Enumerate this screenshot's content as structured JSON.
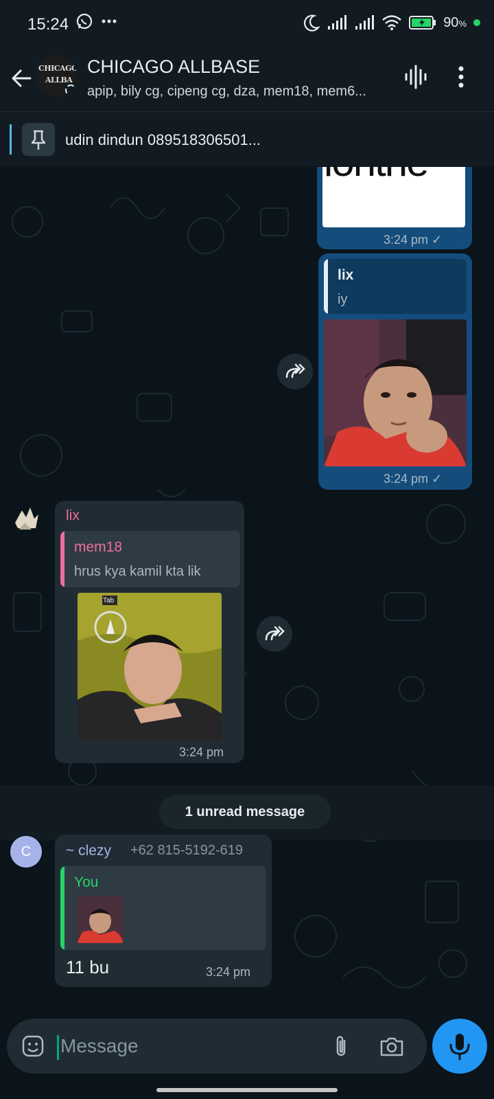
{
  "status_bar": {
    "time": "15:24",
    "battery_percent": "90",
    "battery_suffix": "%"
  },
  "header": {
    "title": "CHICAGO ALLBASE",
    "subtitle": "apip, bily cg, cipeng cg, dza, mem18, mem6...",
    "avatar_text_1": "CHICAGO",
    "avatar_text_2": "ALLBA"
  },
  "pinned": {
    "text": "udin dindun 089518306501..."
  },
  "messages": {
    "m1": {
      "partial_text": "ionthe",
      "time": "3:24 pm"
    },
    "m2": {
      "quote_name": "lix",
      "quote_text": "iy",
      "time": "3:24 pm"
    },
    "m3": {
      "sender": "lix",
      "quote_name": "mem18",
      "quote_text": "hrus kya kamil kta lik",
      "photo_label": "Tab",
      "time": "3:24 pm"
    },
    "unread": "1 unread message",
    "m4": {
      "sender": "~ clezy",
      "phone": "+62 815-5192-619",
      "quote_name": "You",
      "text": "11 bu",
      "time": "3:24 pm",
      "avatar_letter": "C"
    }
  },
  "input": {
    "placeholder": "Message"
  },
  "colors": {
    "accent": "#00a884",
    "bubble_out": "#144d7c",
    "bubble_in": "#202c33",
    "mic": "#2196f3",
    "lix_name": "#ee6d9f",
    "you_name": "#25d366",
    "clezy_name": "#a6b3e8"
  },
  "icons": [
    "back-arrow-icon",
    "voice-chat-icon",
    "more-vertical-icon",
    "pin-icon",
    "forward-icon",
    "emoji-icon",
    "attach-icon",
    "camera-icon",
    "mic-icon",
    "whatsapp-icon",
    "moon-icon",
    "wifi-icon",
    "battery-icon"
  ]
}
